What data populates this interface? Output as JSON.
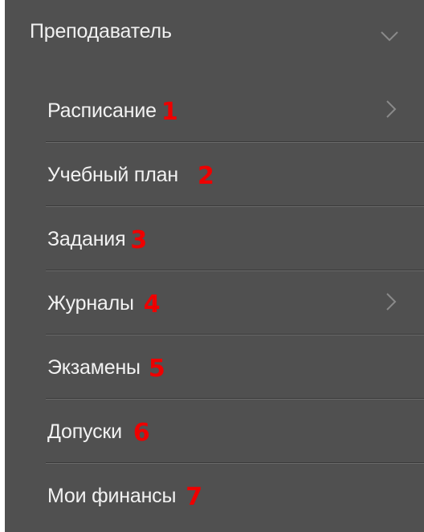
{
  "menu": {
    "section_title": "Преподаватель",
    "section_icon": "chevron-down-icon",
    "items": [
      {
        "label": "Расписание",
        "number": "1",
        "has_submenu": true
      },
      {
        "label": "Учебный план",
        "number": "2",
        "has_submenu": false
      },
      {
        "label": "Задания",
        "number": "3",
        "has_submenu": false
      },
      {
        "label": "Журналы",
        "number": "4",
        "has_submenu": true
      },
      {
        "label": "Экзамены",
        "number": "5",
        "has_submenu": false
      },
      {
        "label": "Допуски",
        "number": "6",
        "has_submenu": false
      },
      {
        "label": "Мои финансы",
        "number": "7",
        "has_submenu": false
      }
    ]
  },
  "colors": {
    "background": "#505050",
    "text": "#f2f2f2",
    "annotation": "#ee0000",
    "chevron": "#8a8a8a"
  }
}
